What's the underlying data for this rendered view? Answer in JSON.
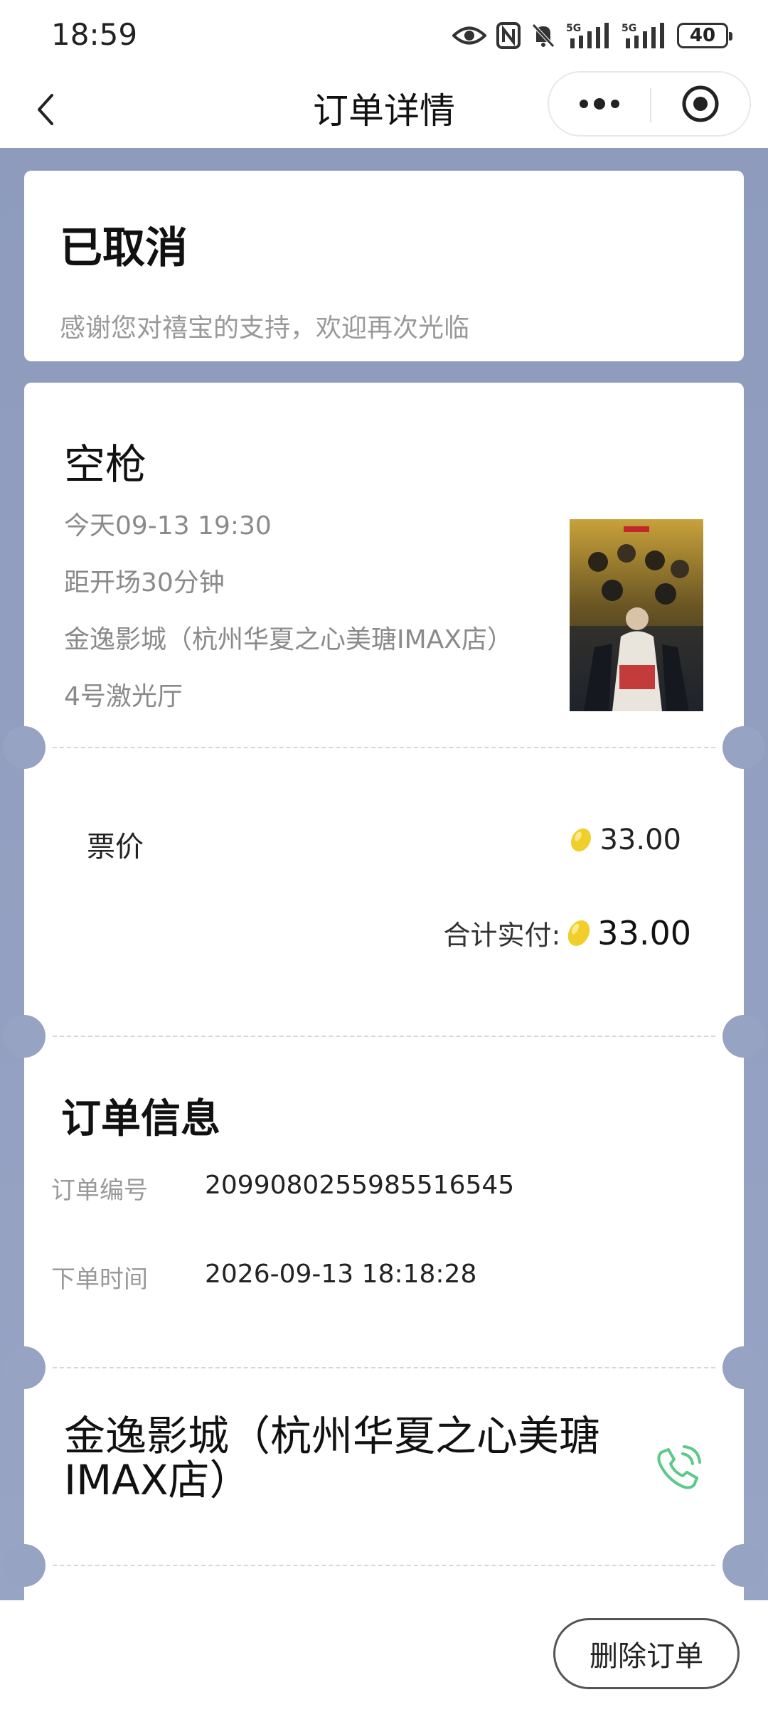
{
  "status_bar": {
    "time": "18:59",
    "battery": "40",
    "network_labels": [
      "5G",
      "5G"
    ]
  },
  "nav": {
    "title": "订单详情"
  },
  "order_status": {
    "title": "已取消",
    "subtitle": "感谢您对禧宝的支持，欢迎再次光临"
  },
  "movie": {
    "title": "空枪",
    "showtime": "今天09-13 19:30",
    "countdown": "距开场30分钟",
    "cinema": "金逸影城（杭州华夏之心美瑭IMAX店）",
    "hall": "4号激光厅"
  },
  "pricing": {
    "ticket_label": "票价",
    "ticket_value": "33.00",
    "total_label": "合计实付:",
    "total_value": "33.00"
  },
  "order_info": {
    "title": "订单信息",
    "rows": [
      {
        "key": "订单编号",
        "value": "2099080255985516545"
      },
      {
        "key": "下单时间",
        "value": "2026-09-13 18:18:28"
      }
    ]
  },
  "cinema_section": {
    "name": "金逸影城（杭州华夏之心美瑭IMAX店）"
  },
  "actions": {
    "delete_label": "删除订单"
  },
  "colors": {
    "page_background": "#8e9bbd",
    "phone_icon": "#5cc98a",
    "bean_icon": "#f1cf2b"
  }
}
